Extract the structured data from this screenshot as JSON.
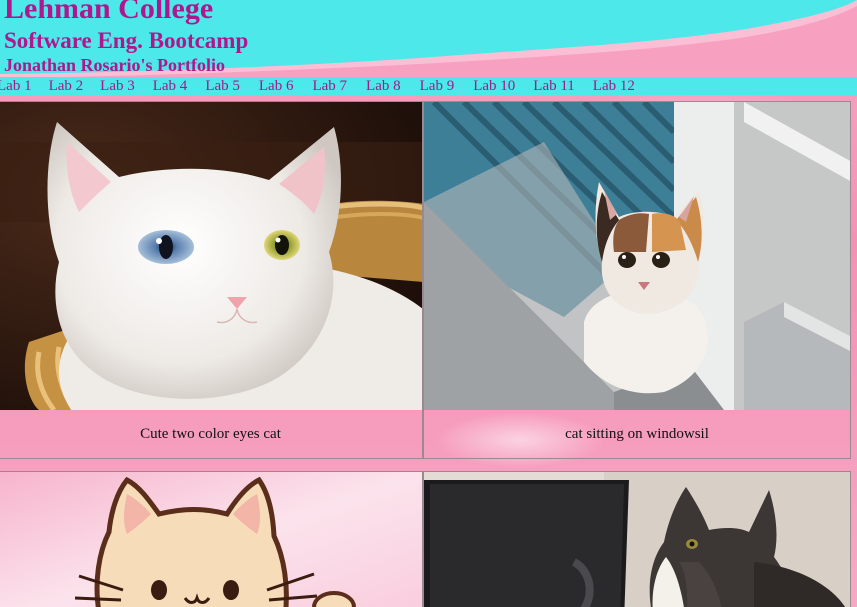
{
  "header": {
    "college": "Lehman College",
    "program": "Software Eng. Bootcamp",
    "portfolio": "Jonathan Rosario's Portfolio"
  },
  "nav": {
    "items": [
      {
        "label": "Lab 1"
      },
      {
        "label": "Lab 2"
      },
      {
        "label": "Lab 3"
      },
      {
        "label": "Lab 4"
      },
      {
        "label": "Lab 5"
      },
      {
        "label": "Lab 6"
      },
      {
        "label": "Lab 7"
      },
      {
        "label": "Lab 8"
      },
      {
        "label": "Lab 9"
      },
      {
        "label": "Lab 10"
      },
      {
        "label": "Lab 11"
      },
      {
        "label": "Lab 12"
      }
    ]
  },
  "gallery": {
    "items": [
      {
        "caption": "Cute two color eyes cat"
      },
      {
        "caption": "cat sitting on windowsil"
      },
      {
        "caption": ""
      },
      {
        "caption": ""
      }
    ]
  },
  "colors": {
    "title": "#b0168d",
    "nav_bg": "#4de8ea",
    "nav_link": "#a01b87",
    "page_bg": "#f590b5"
  }
}
